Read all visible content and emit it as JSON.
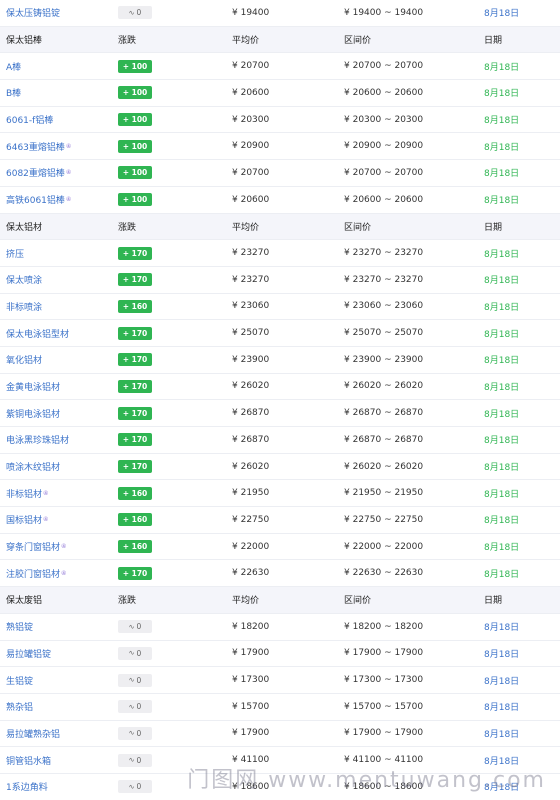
{
  "columns": {
    "name_header": "",
    "change": "涨跌",
    "avg": "平均价",
    "range": "区间价",
    "date": "日期"
  },
  "rows": [
    {
      "type": "item",
      "name": "保太压铸铝锭",
      "change": "0",
      "dir": "flat",
      "avg": "¥ 19400",
      "range": "¥ 19400 ~ 19400",
      "date": "8月18日",
      "date_color": "blue"
    },
    {
      "type": "header",
      "name": "保太铝棒",
      "change": "涨跌",
      "avg": "平均价",
      "range": "区间价",
      "date": "日期"
    },
    {
      "type": "item",
      "name": "A棒",
      "change": "+ 100",
      "dir": "up",
      "avg": "¥ 20700",
      "range": "¥ 20700 ~ 20700",
      "date": "8月18日",
      "date_color": "green"
    },
    {
      "type": "item",
      "name": "B棒",
      "change": "+ 100",
      "dir": "up",
      "avg": "¥ 20600",
      "range": "¥ 20600 ~ 20600",
      "date": "8月18日",
      "date_color": "green"
    },
    {
      "type": "item",
      "name": "6061-f铝棒",
      "change": "+ 100",
      "dir": "up",
      "avg": "¥ 20300",
      "range": "¥ 20300 ~ 20300",
      "date": "8月18日",
      "date_color": "green"
    },
    {
      "type": "item",
      "name": "6463重熔铝棒",
      "change": "+ 100",
      "dir": "up",
      "avg": "¥ 20900",
      "range": "¥ 20900 ~ 20900",
      "date": "8月18日",
      "date_color": "green",
      "sup": "④"
    },
    {
      "type": "item",
      "name": "6082重熔铝棒",
      "change": "+ 100",
      "dir": "up",
      "avg": "¥ 20700",
      "range": "¥ 20700 ~ 20700",
      "date": "8月18日",
      "date_color": "green",
      "sup": "④"
    },
    {
      "type": "item",
      "name": "高铁6061铝棒",
      "change": "+ 100",
      "dir": "up",
      "avg": "¥ 20600",
      "range": "¥ 20600 ~ 20600",
      "date": "8月18日",
      "date_color": "green",
      "sup": "④"
    },
    {
      "type": "header",
      "name": "保太铝材",
      "change": "涨跌",
      "avg": "平均价",
      "range": "区间价",
      "date": "日期"
    },
    {
      "type": "item",
      "name": "挤压",
      "change": "+ 170",
      "dir": "up",
      "avg": "¥ 23270",
      "range": "¥ 23270 ~ 23270",
      "date": "8月18日",
      "date_color": "green"
    },
    {
      "type": "item",
      "name": "保太喷涂",
      "change": "+ 170",
      "dir": "up",
      "avg": "¥ 23270",
      "range": "¥ 23270 ~ 23270",
      "date": "8月18日",
      "date_color": "green"
    },
    {
      "type": "item",
      "name": "非标喷涂",
      "change": "+ 160",
      "dir": "up",
      "avg": "¥ 23060",
      "range": "¥ 23060 ~ 23060",
      "date": "8月18日",
      "date_color": "green"
    },
    {
      "type": "item",
      "name": "保太电泳铝型材",
      "change": "+ 170",
      "dir": "up",
      "avg": "¥ 25070",
      "range": "¥ 25070 ~ 25070",
      "date": "8月18日",
      "date_color": "green"
    },
    {
      "type": "item",
      "name": "氧化铝材",
      "change": "+ 170",
      "dir": "up",
      "avg": "¥ 23900",
      "range": "¥ 23900 ~ 23900",
      "date": "8月18日",
      "date_color": "green"
    },
    {
      "type": "item",
      "name": "金黄电泳铝材",
      "change": "+ 170",
      "dir": "up",
      "avg": "¥ 26020",
      "range": "¥ 26020 ~ 26020",
      "date": "8月18日",
      "date_color": "green"
    },
    {
      "type": "item",
      "name": "紫铜电泳铝材",
      "change": "+ 170",
      "dir": "up",
      "avg": "¥ 26870",
      "range": "¥ 26870 ~ 26870",
      "date": "8月18日",
      "date_color": "green"
    },
    {
      "type": "item",
      "name": "电泳黑珍珠铝材",
      "change": "+ 170",
      "dir": "up",
      "avg": "¥ 26870",
      "range": "¥ 26870 ~ 26870",
      "date": "8月18日",
      "date_color": "green"
    },
    {
      "type": "item",
      "name": "喷涂木纹铝材",
      "change": "+ 170",
      "dir": "up",
      "avg": "¥ 26020",
      "range": "¥ 26020 ~ 26020",
      "date": "8月18日",
      "date_color": "green"
    },
    {
      "type": "item",
      "name": "非标铝材",
      "change": "+ 160",
      "dir": "up",
      "avg": "¥ 21950",
      "range": "¥ 21950 ~ 21950",
      "date": "8月18日",
      "date_color": "green",
      "sup": "④"
    },
    {
      "type": "item",
      "name": "国标铝材",
      "change": "+ 160",
      "dir": "up",
      "avg": "¥ 22750",
      "range": "¥ 22750 ~ 22750",
      "date": "8月18日",
      "date_color": "green",
      "sup": "④"
    },
    {
      "type": "item",
      "name": "穿条门窗铝材",
      "change": "+ 160",
      "dir": "up",
      "avg": "¥ 22000",
      "range": "¥ 22000 ~ 22000",
      "date": "8月18日",
      "date_color": "green",
      "sup": "④"
    },
    {
      "type": "item",
      "name": "注胶门窗铝材",
      "change": "+ 170",
      "dir": "up",
      "avg": "¥ 22630",
      "range": "¥ 22630 ~ 22630",
      "date": "8月18日",
      "date_color": "green",
      "sup": "④"
    },
    {
      "type": "header",
      "name": "保太废铝",
      "change": "涨跌",
      "avg": "平均价",
      "range": "区间价",
      "date": "日期"
    },
    {
      "type": "item",
      "name": "熟铝锭",
      "change": "0",
      "dir": "flat",
      "avg": "¥ 18200",
      "range": "¥ 18200 ~ 18200",
      "date": "8月18日",
      "date_color": "blue"
    },
    {
      "type": "item",
      "name": "易拉罐铝锭",
      "change": "0",
      "dir": "flat",
      "avg": "¥ 17900",
      "range": "¥ 17900 ~ 17900",
      "date": "8月18日",
      "date_color": "blue"
    },
    {
      "type": "item",
      "name": "生铝锭",
      "change": "0",
      "dir": "flat",
      "avg": "¥ 17300",
      "range": "¥ 17300 ~ 17300",
      "date": "8月18日",
      "date_color": "blue"
    },
    {
      "type": "item",
      "name": "熟杂铝",
      "change": "0",
      "dir": "flat",
      "avg": "¥ 15700",
      "range": "¥ 15700 ~ 15700",
      "date": "8月18日",
      "date_color": "blue"
    },
    {
      "type": "item",
      "name": "易拉罐熟杂铝",
      "change": "0",
      "dir": "flat",
      "avg": "¥ 17900",
      "range": "¥ 17900 ~ 17900",
      "date": "8月18日",
      "date_color": "blue"
    },
    {
      "type": "item",
      "name": "铜管铝水箱",
      "change": "0",
      "dir": "flat",
      "avg": "¥ 41100",
      "range": "¥ 41100 ~ 41100",
      "date": "8月18日",
      "date_color": "blue"
    },
    {
      "type": "item",
      "name": "1系边角料",
      "change": "0",
      "dir": "flat",
      "avg": "¥ 18600",
      "range": "¥ 18600 ~ 18600",
      "date": "8月18日",
      "date_color": "blue"
    }
  ],
  "watermark": "门图网 www.mentuwang.com",
  "colors": {
    "up": "#2fb552",
    "link": "#3b72c9",
    "header_bg": "#f4f5fa"
  }
}
